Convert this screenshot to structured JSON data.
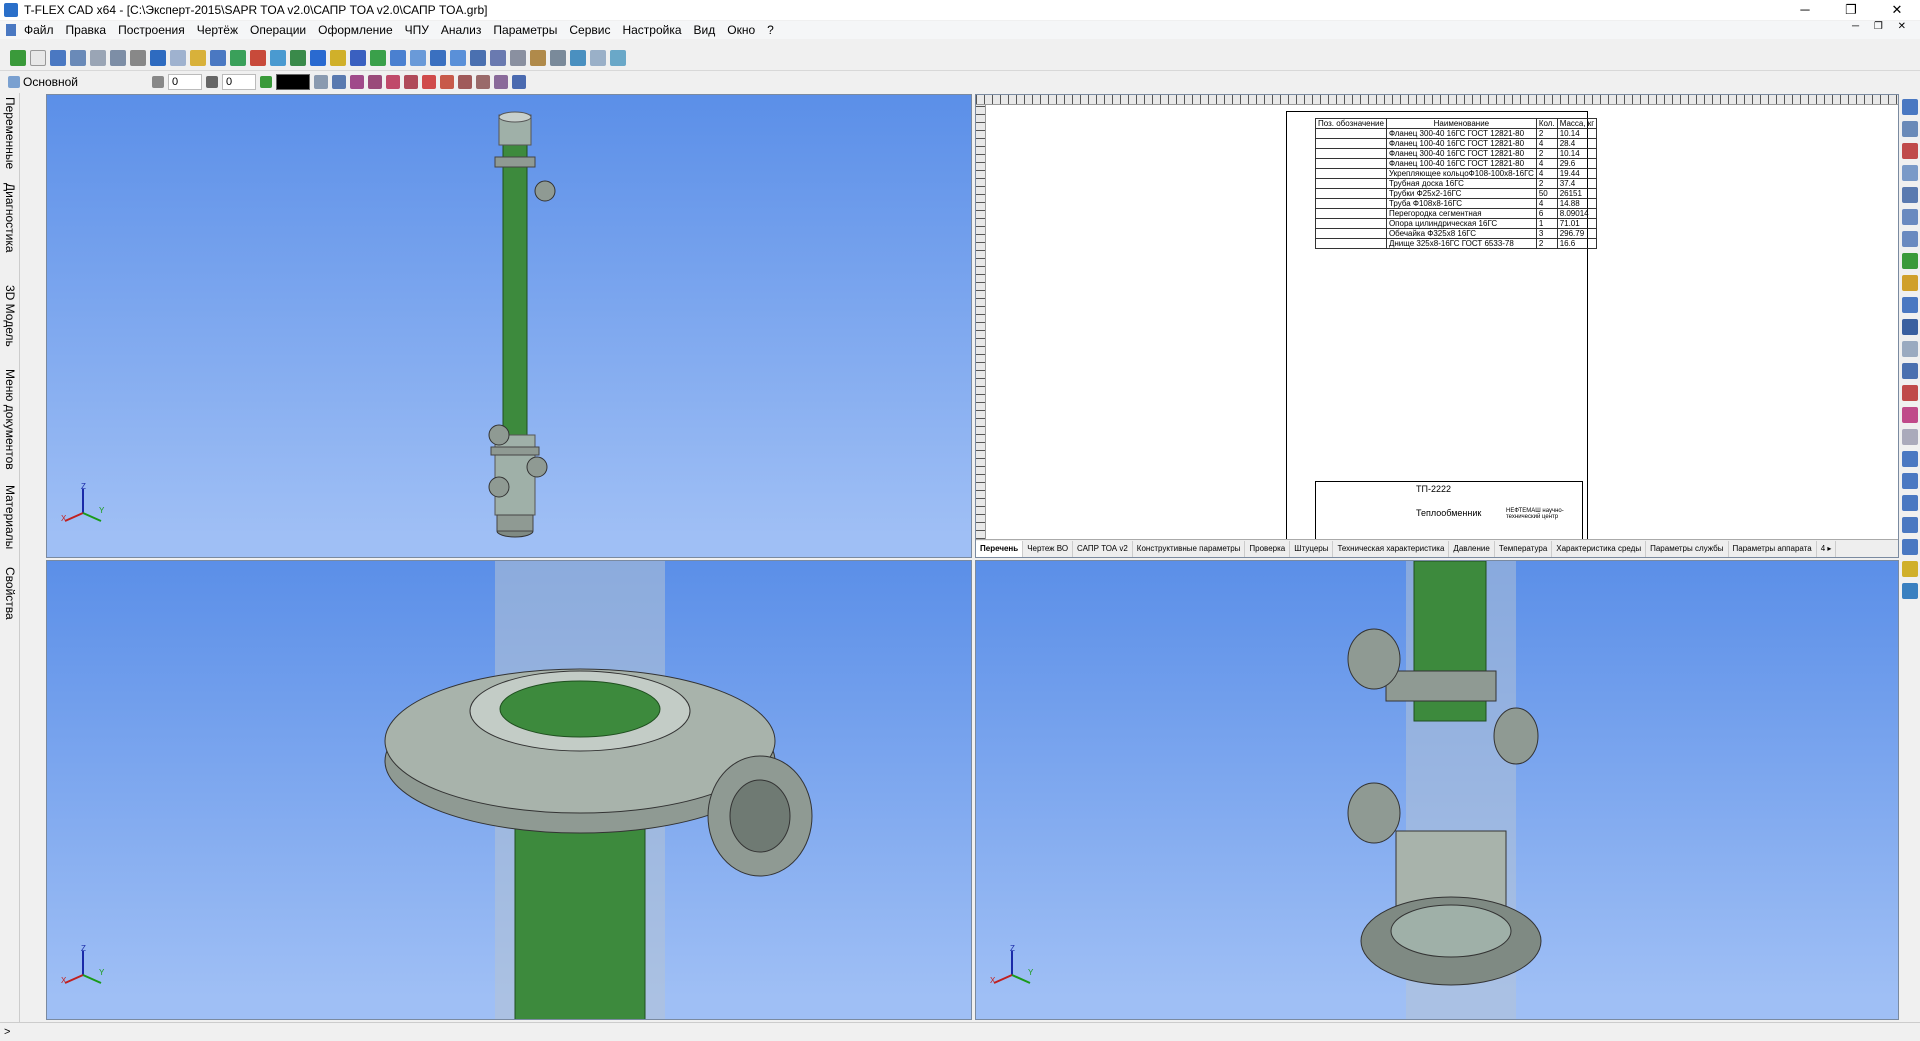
{
  "window": {
    "title": "T-FLEX CAD x64 - [C:\\Эксперт-2015\\SAPR TOA v2.0\\САПР TOA v2.0\\САПР TOA.grb]",
    "minimize": "─",
    "maximize": "❐",
    "close": "✕"
  },
  "menu": {
    "items": [
      "Файл",
      "Правка",
      "Построения",
      "Чертёж",
      "Операции",
      "Оформление",
      "ЧПУ",
      "Анализ",
      "Параметры",
      "Сервис",
      "Настройка",
      "Вид",
      "Окно",
      "?"
    ]
  },
  "toolbar2": {
    "layer_name": "Основной",
    "value1": "0",
    "value2": "0",
    "current_color": "#000000"
  },
  "left_tabs": [
    "Переменные",
    "Диагностика",
    "3D Модель",
    "Меню документов",
    "Материалы",
    "Свойства"
  ],
  "drawing": {
    "spec_header": [
      "Поз. обозначение",
      "Наименование",
      "Кол.",
      "Масса, кг"
    ],
    "spec_rows": [
      [
        "",
        "Фланец 300-40 16ГС ГОСТ 12821-80",
        "2",
        "10.14"
      ],
      [
        "",
        "Фланец 100-40 16ГС ГОСТ 12821-80",
        "4",
        "28.4"
      ],
      [
        "",
        "Фланец 300-40 16ГС ГОСТ 12821-80",
        "2",
        "10.14"
      ],
      [
        "",
        "Фланец 100-40 16ГС ГОСТ 12821-80",
        "4",
        "29.6"
      ],
      [
        "",
        "Укрепляющее кольцоФ108-100х8-16ГС",
        "4",
        "19.44"
      ],
      [
        "",
        "Трубная доска 16ГС",
        "2",
        "37.4"
      ],
      [
        "",
        "Трубки Ф25х2-16ГС",
        "50",
        "26151"
      ],
      [
        "",
        "Труба Ф108х8-16ГС",
        "4",
        "14.88"
      ],
      [
        "",
        "Перегородка сегментная",
        "6",
        "8.09014"
      ],
      [
        "",
        "Опора цилиндрическая 16ГС",
        "1",
        "71.01"
      ],
      [
        "",
        "Обечайка Ф325х8 16ГС",
        "3",
        "296.79"
      ],
      [
        "",
        "Днище 325х8-16ГС ГОСТ 6533-78",
        "2",
        "16.6"
      ]
    ],
    "stamp_code": "ТП-2222",
    "stamp_name": "Теплообменник",
    "stamp_org": "НЕФТЕМАШ научно-технический центр",
    "tabs": [
      "Перечень",
      "Чертеж ВО",
      "САПР ТОА v2",
      "Конструктивные параметры",
      "Проверка",
      "Штуцеры",
      "Техническая характеристика",
      "Давление",
      "Температура",
      "Характеристика среды",
      "Параметры службы",
      "Параметры аппарата"
    ],
    "tabs_more": "4 ▸"
  },
  "axes": {
    "x": "X",
    "y": "Y",
    "z": "Z"
  },
  "status": {
    "text": ">"
  },
  "colors": {
    "viewport_top": "#5b8fe8",
    "viewport_bottom": "#9fbff5",
    "body_green": "#3d8a3d",
    "metal": "#8f9a93"
  }
}
